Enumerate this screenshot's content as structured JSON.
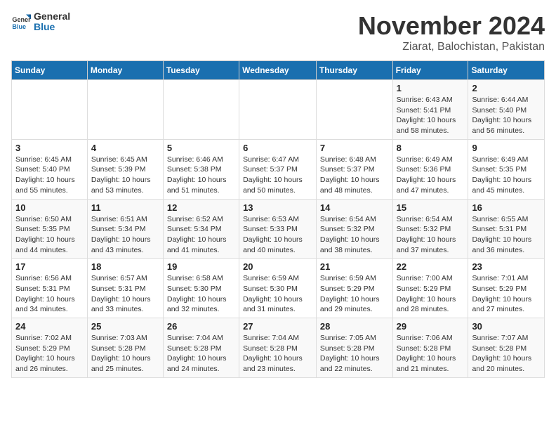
{
  "header": {
    "logo_line1": "General",
    "logo_line2": "Blue",
    "month": "November 2024",
    "location": "Ziarat, Balochistan, Pakistan"
  },
  "weekdays": [
    "Sunday",
    "Monday",
    "Tuesday",
    "Wednesday",
    "Thursday",
    "Friday",
    "Saturday"
  ],
  "weeks": [
    [
      {
        "day": "",
        "info": ""
      },
      {
        "day": "",
        "info": ""
      },
      {
        "day": "",
        "info": ""
      },
      {
        "day": "",
        "info": ""
      },
      {
        "day": "",
        "info": ""
      },
      {
        "day": "1",
        "info": "Sunrise: 6:43 AM\nSunset: 5:41 PM\nDaylight: 10 hours and 58 minutes."
      },
      {
        "day": "2",
        "info": "Sunrise: 6:44 AM\nSunset: 5:40 PM\nDaylight: 10 hours and 56 minutes."
      }
    ],
    [
      {
        "day": "3",
        "info": "Sunrise: 6:45 AM\nSunset: 5:40 PM\nDaylight: 10 hours and 55 minutes."
      },
      {
        "day": "4",
        "info": "Sunrise: 6:45 AM\nSunset: 5:39 PM\nDaylight: 10 hours and 53 minutes."
      },
      {
        "day": "5",
        "info": "Sunrise: 6:46 AM\nSunset: 5:38 PM\nDaylight: 10 hours and 51 minutes."
      },
      {
        "day": "6",
        "info": "Sunrise: 6:47 AM\nSunset: 5:37 PM\nDaylight: 10 hours and 50 minutes."
      },
      {
        "day": "7",
        "info": "Sunrise: 6:48 AM\nSunset: 5:37 PM\nDaylight: 10 hours and 48 minutes."
      },
      {
        "day": "8",
        "info": "Sunrise: 6:49 AM\nSunset: 5:36 PM\nDaylight: 10 hours and 47 minutes."
      },
      {
        "day": "9",
        "info": "Sunrise: 6:49 AM\nSunset: 5:35 PM\nDaylight: 10 hours and 45 minutes."
      }
    ],
    [
      {
        "day": "10",
        "info": "Sunrise: 6:50 AM\nSunset: 5:35 PM\nDaylight: 10 hours and 44 minutes."
      },
      {
        "day": "11",
        "info": "Sunrise: 6:51 AM\nSunset: 5:34 PM\nDaylight: 10 hours and 43 minutes."
      },
      {
        "day": "12",
        "info": "Sunrise: 6:52 AM\nSunset: 5:34 PM\nDaylight: 10 hours and 41 minutes."
      },
      {
        "day": "13",
        "info": "Sunrise: 6:53 AM\nSunset: 5:33 PM\nDaylight: 10 hours and 40 minutes."
      },
      {
        "day": "14",
        "info": "Sunrise: 6:54 AM\nSunset: 5:32 PM\nDaylight: 10 hours and 38 minutes."
      },
      {
        "day": "15",
        "info": "Sunrise: 6:54 AM\nSunset: 5:32 PM\nDaylight: 10 hours and 37 minutes."
      },
      {
        "day": "16",
        "info": "Sunrise: 6:55 AM\nSunset: 5:31 PM\nDaylight: 10 hours and 36 minutes."
      }
    ],
    [
      {
        "day": "17",
        "info": "Sunrise: 6:56 AM\nSunset: 5:31 PM\nDaylight: 10 hours and 34 minutes."
      },
      {
        "day": "18",
        "info": "Sunrise: 6:57 AM\nSunset: 5:31 PM\nDaylight: 10 hours and 33 minutes."
      },
      {
        "day": "19",
        "info": "Sunrise: 6:58 AM\nSunset: 5:30 PM\nDaylight: 10 hours and 32 minutes."
      },
      {
        "day": "20",
        "info": "Sunrise: 6:59 AM\nSunset: 5:30 PM\nDaylight: 10 hours and 31 minutes."
      },
      {
        "day": "21",
        "info": "Sunrise: 6:59 AM\nSunset: 5:29 PM\nDaylight: 10 hours and 29 minutes."
      },
      {
        "day": "22",
        "info": "Sunrise: 7:00 AM\nSunset: 5:29 PM\nDaylight: 10 hours and 28 minutes."
      },
      {
        "day": "23",
        "info": "Sunrise: 7:01 AM\nSunset: 5:29 PM\nDaylight: 10 hours and 27 minutes."
      }
    ],
    [
      {
        "day": "24",
        "info": "Sunrise: 7:02 AM\nSunset: 5:29 PM\nDaylight: 10 hours and 26 minutes."
      },
      {
        "day": "25",
        "info": "Sunrise: 7:03 AM\nSunset: 5:28 PM\nDaylight: 10 hours and 25 minutes."
      },
      {
        "day": "26",
        "info": "Sunrise: 7:04 AM\nSunset: 5:28 PM\nDaylight: 10 hours and 24 minutes."
      },
      {
        "day": "27",
        "info": "Sunrise: 7:04 AM\nSunset: 5:28 PM\nDaylight: 10 hours and 23 minutes."
      },
      {
        "day": "28",
        "info": "Sunrise: 7:05 AM\nSunset: 5:28 PM\nDaylight: 10 hours and 22 minutes."
      },
      {
        "day": "29",
        "info": "Sunrise: 7:06 AM\nSunset: 5:28 PM\nDaylight: 10 hours and 21 minutes."
      },
      {
        "day": "30",
        "info": "Sunrise: 7:07 AM\nSunset: 5:28 PM\nDaylight: 10 hours and 20 minutes."
      }
    ]
  ]
}
